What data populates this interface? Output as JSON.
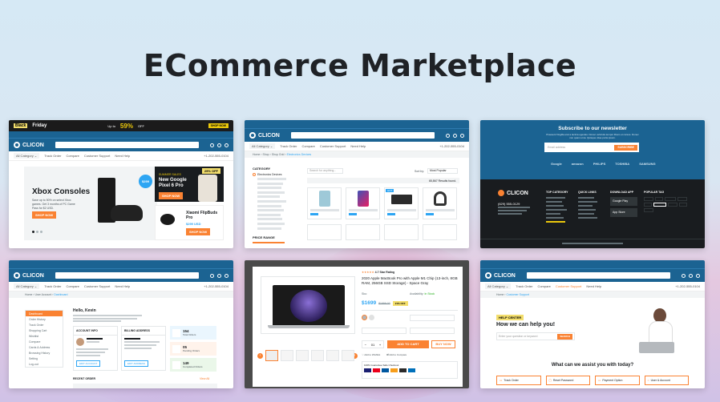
{
  "page": {
    "title": "ECommerce Marketplace"
  },
  "colors": {
    "brand_blue": "#1b6392",
    "accent_orange": "#fa8232",
    "black_friday_yellow": "#f3de6d",
    "dark": "#1b1b1b"
  },
  "card1": {
    "promo_black": "Black",
    "promo_friday": "Friday",
    "promo_up_to": "Up to",
    "promo_percent": "59%",
    "promo_off": "OFF",
    "shop_now": "SHOP NOW",
    "logo": "CLICON",
    "hero_title": "Xbox Consoles",
    "hero_badge": "$299",
    "side_tag": "SUMMER SALES",
    "side_title": "New Google Pixel 6 Pro",
    "side_off": "29% OFF",
    "earbuds_title": "Xiaomi FlipBuds Pro",
    "earbuds_price": "$299 USD",
    "phone": "+1-202-555-0104"
  },
  "card2": {
    "logo": "CLICON",
    "phone": "+1-202-555-0104",
    "filter_heading": "CATEGORY",
    "category_first": "Electronics Devices",
    "price_heading": "PRICE RANGE",
    "sort_label": "Sort by:",
    "sort_value": "Most Popular",
    "results": "65,867 Results found.",
    "hot_tag": "HOT"
  },
  "card3": {
    "newsletter_title": "Subscribe to our newsletter",
    "email_placeholder": "Email address",
    "subscribe": "SUBSCRIBE",
    "brands": [
      "Google",
      "amazon",
      "PHILIPS",
      "TOSHIBA",
      "SAMSUNG"
    ],
    "logo": "CLICON",
    "top_category": "TOP CATEGORY",
    "quick_links": "QUICK LINKS",
    "download_app": "DOWNLOAD APP",
    "popular_tag": "POPULAR TAG",
    "google_play": "Google Play",
    "app_store": "App Store",
    "phone": "(629) 555-0129"
  },
  "card4": {
    "logo": "CLICON",
    "greeting": "Hello, Kevin",
    "account_info": "ACCOUNT INFO",
    "billing_address": "BILLING ADDRESS",
    "edit_account": "EDIT ACCOUNT",
    "edit_address": "EDIT ADDRESS",
    "stats": [
      {
        "value": "154",
        "label": "Total Orders"
      },
      {
        "value": "05",
        "label": "Pending Orders"
      },
      {
        "value": "149",
        "label": "Completed Orders"
      }
    ],
    "sidebar": [
      "Dashboard",
      "Order History",
      "Track Order",
      "Shopping Cart",
      "Wishlist",
      "Compare",
      "Cards & Address",
      "Browsing History",
      "Setting",
      "Log-out"
    ],
    "recent_order": "RECENT ORDER",
    "view_all": "View All"
  },
  "card5": {
    "rating_text": "4.7 Star Rating",
    "title": "2020 Apple MacBook Pro with Apple M1 Chip (13-inch, 8GB RAM, 256GB SSD Storage) - Space Gray",
    "price": "$1699",
    "old_price": "$1999.00",
    "discount": "21% OFF",
    "add_to_cart": "ADD TO CART",
    "buy_now": "BUY NOW",
    "sku_label": "Sku:",
    "availability_label": "Availability:",
    "availability_value": "In Stock",
    "qty": "01",
    "secure_checkout": "100% Guarantee Safe Checkout"
  },
  "card6": {
    "logo": "CLICON",
    "help_tag": "HELP CENTER",
    "help_title": "How we can help you!",
    "search_placeholder": "Enter your question or keyword",
    "search_button": "SEARCH",
    "assist_title": "What can we assist you with today?",
    "topics": [
      "Track Order",
      "Reset Password",
      "Payment Option",
      "User & Account"
    ],
    "phone": "+1-202-555-0104"
  }
}
